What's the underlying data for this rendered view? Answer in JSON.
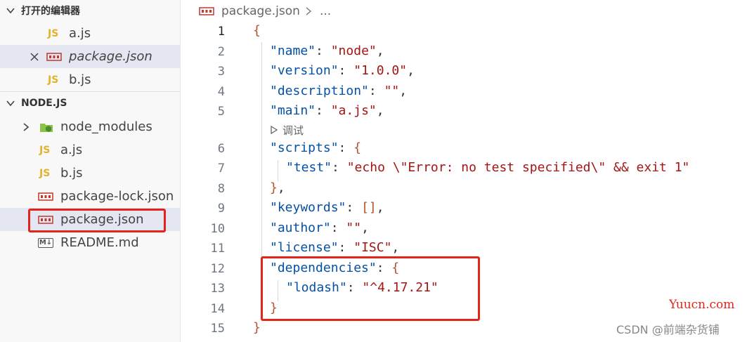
{
  "sidebar": {
    "open_editors": {
      "title": "打开的编辑器",
      "items": [
        {
          "label": "a.js",
          "icon": "js-icon"
        },
        {
          "label": "package.json",
          "icon": "json-icon",
          "close": "close-icon"
        },
        {
          "label": "b.js",
          "icon": "js-icon"
        }
      ]
    },
    "project": {
      "title": "NODE.JS",
      "items": [
        {
          "label": "node_modules",
          "icon": "nodejs-folder-icon"
        },
        {
          "label": "a.js",
          "icon": "js-icon"
        },
        {
          "label": "b.js",
          "icon": "js-icon"
        },
        {
          "label": "package-lock.json",
          "icon": "json-icon"
        },
        {
          "label": "package.json",
          "icon": "json-icon"
        },
        {
          "label": "README.md",
          "icon": "markdown-icon"
        }
      ]
    },
    "js_badge": "JS",
    "md_badge": "M↓"
  },
  "editor": {
    "breadcrumb": {
      "file": "package.json",
      "more": "..."
    },
    "codelens": "调试",
    "line_numbers": [
      "1",
      "2",
      "3",
      "4",
      "5",
      "6",
      "7",
      "8",
      "9",
      "10",
      "11",
      "12",
      "13",
      "14",
      "15"
    ],
    "lines": {
      "l1": "{",
      "l2": {
        "key": "\"name\"",
        "colon": ": ",
        "value": "\"node\"",
        "comma": ","
      },
      "l3": {
        "key": "\"version\"",
        "colon": ": ",
        "value": "\"1.0.0\"",
        "comma": ","
      },
      "l4": {
        "key": "\"description\"",
        "colon": ": ",
        "value": "\"\"",
        "comma": ","
      },
      "l5": {
        "key": "\"main\"",
        "colon": ": ",
        "value": "\"a.js\"",
        "comma": ","
      },
      "l6": {
        "key": "\"scripts\"",
        "colon": ": ",
        "brace": "{"
      },
      "l7": {
        "key": "\"test\"",
        "colon": ": ",
        "value": "\"echo \\\"Error: no test specified\\\" && exit 1\""
      },
      "l8": {
        "brace": "}",
        "comma": ","
      },
      "l9": {
        "key": "\"keywords\"",
        "colon": ": ",
        "brace": "[]",
        "comma": ","
      },
      "l10": {
        "key": "\"author\"",
        "colon": ": ",
        "value": "\"\"",
        "comma": ","
      },
      "l11": {
        "key": "\"license\"",
        "colon": ": ",
        "value": "\"ISC\"",
        "comma": ","
      },
      "l12": {
        "key": "\"dependencies\"",
        "colon": ": ",
        "brace": "{"
      },
      "l13": {
        "key": "\"lodash\"",
        "colon": ": ",
        "value": "\"^4.17.21\""
      },
      "l14": {
        "brace": "}"
      },
      "l15": "}"
    }
  },
  "watermarks": {
    "site": "Yuucn.com",
    "csdn": "CSDN @前端杂货铺"
  },
  "colors": {
    "highlight": "#e3241b",
    "key": "#0451a5",
    "string": "#a31515",
    "bracket": "#b5522d",
    "js": "#e2b22b",
    "selected": "#e4e6f1"
  }
}
